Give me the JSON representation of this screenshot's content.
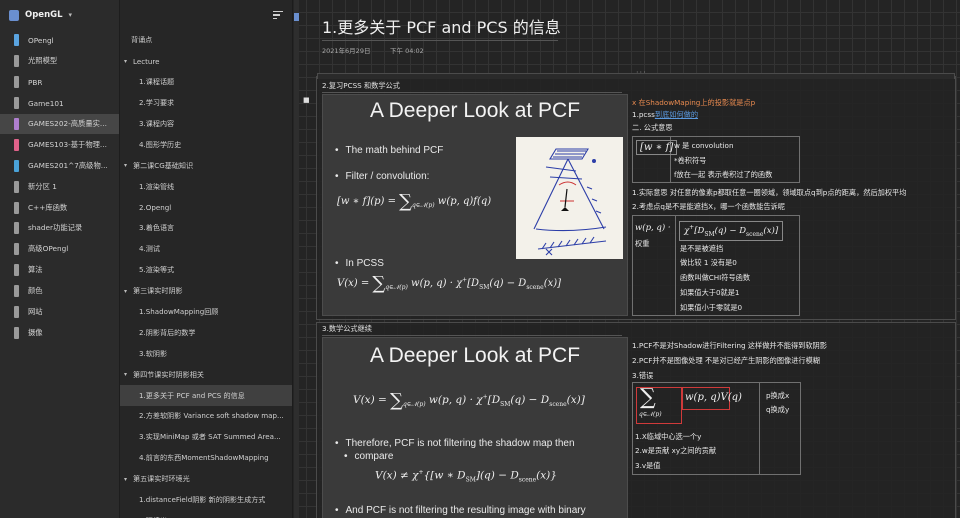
{
  "notebook": {
    "title": "OpenGL"
  },
  "notebooks": [
    {
      "label": "OPengl",
      "color": "#5aa4e0",
      "active": false
    },
    {
      "label": "光照模型",
      "color": "#9a9a9a",
      "active": false
    },
    {
      "label": "PBR",
      "color": "#9a9a9a",
      "active": false
    },
    {
      "label": "Game101",
      "color": "#9a9a9a",
      "active": false
    },
    {
      "label": "GAMES202-高质量实...",
      "color": "#b07fd0",
      "active": true
    },
    {
      "label": "GAMES103-基于物理...",
      "color": "#e0628a",
      "active": false
    },
    {
      "label": "GAMES201^7高级物...",
      "color": "#4aa2d8",
      "active": false
    },
    {
      "label": "新分区 1",
      "color": "#9a9a9a",
      "active": false
    },
    {
      "label": "C++库函数",
      "color": "#9a9a9a",
      "active": false
    },
    {
      "label": "shader功能记录",
      "color": "#9a9a9a",
      "active": false
    },
    {
      "label": "高级OPengl",
      "color": "#9a9a9a",
      "active": false
    },
    {
      "label": "算法",
      "color": "#9a9a9a",
      "active": false
    },
    {
      "label": "颜色",
      "color": "#9a9a9a",
      "active": false
    },
    {
      "label": "网站",
      "color": "#9a9a9a",
      "active": false
    },
    {
      "label": "摄像",
      "color": "#9a9a9a",
      "active": false
    }
  ],
  "sections": [
    {
      "label": "背诵点",
      "kind": "top"
    },
    {
      "label": "Lecture",
      "kind": "group"
    },
    {
      "label": "1.课程话题",
      "kind": "page"
    },
    {
      "label": "2.学习要求",
      "kind": "page"
    },
    {
      "label": "3.课程内容",
      "kind": "page"
    },
    {
      "label": "4.图形学历史",
      "kind": "page"
    },
    {
      "label": "第二课CG基础知识",
      "kind": "group"
    },
    {
      "label": "1.渲染管线",
      "kind": "page"
    },
    {
      "label": "2.Opengl",
      "kind": "page"
    },
    {
      "label": "3.着色语言",
      "kind": "page"
    },
    {
      "label": "4.测试",
      "kind": "page"
    },
    {
      "label": "5.渲染等式",
      "kind": "page"
    },
    {
      "label": "第三课实时阴影",
      "kind": "group"
    },
    {
      "label": "1.ShadowMapping回顾",
      "kind": "page"
    },
    {
      "label": "2.阴影背后的数学",
      "kind": "page"
    },
    {
      "label": "3.软阴影",
      "kind": "page"
    },
    {
      "label": "第四节课实时阴影相关",
      "kind": "group"
    },
    {
      "label": "1.更多关于 PCF and PCS 的信息",
      "kind": "page",
      "active": true
    },
    {
      "label": "2.方差软阴影 Variance soft shadow map...",
      "kind": "page"
    },
    {
      "label": "3.实现MiniMap 或者 SAT Summed Area...",
      "kind": "page"
    },
    {
      "label": "4.前言的东西MomentShadowMapping",
      "kind": "page"
    },
    {
      "label": "第五课实时环境光",
      "kind": "group"
    },
    {
      "label": "1.distanceField阴影 新的阴影生成方式",
      "kind": "page"
    },
    {
      "label": "2.环境光",
      "kind": "page"
    }
  ],
  "page": {
    "title": "1.更多关于 PCF and PCS 的信息",
    "date": "2021年6月29日",
    "time": "下午 04:02"
  },
  "block1": {
    "heading": "2.复习PCSS 和数学公式",
    "slide_title": "A Deeper Look at PCF",
    "bullet1": "The math behind PCF",
    "bullet2": "Filter / convolution:",
    "bullet3": "In PCSS",
    "notes": {
      "line1": "x 在ShadowMaping上的投影就是点p",
      "line2_prefix": "1.pcss",
      "line2_link": "到底如何做的",
      "line3": "二. 公式意思",
      "def_title": "w 是 convolution",
      "def_star": "*卷积符号",
      "def_f": "f放在一起 表示卷积过了的函数",
      "line4": "1.实际意思 对任意的像素p都取任意一圈领域，领域取点q到p点的距离，然后加权平均",
      "line5": "2.考虑点q是不是能遮挡X，哪一个函数能告诉呢",
      "weight": "权重",
      "chi1": "是不是被遮挡",
      "chi2": "做比较 1 没有是0",
      "chi3": "函数叫做CHI符号函数",
      "chi4": "如果值大于0就是1",
      "chi5": "如果值小于零就是0"
    }
  },
  "block2": {
    "heading": "3.数学公式继续",
    "slide_title": "A Deeper Look at PCF",
    "bullet1": "Therefore, PCF is not filtering the shadow map then",
    "bullet1b": "compare",
    "bullet2": "And PCF is not filtering the resulting image with binary",
    "notes": {
      "line1": "1.PCF不是对Shadow进行Filtering 这样做并不能得到软阴影",
      "line2": "2.PCF并不是图像处理 不是对已经产生阴影的图像进行模糊",
      "line3": "3.错误",
      "px": "p换成x",
      "qy": "q换成y",
      "e1": "1.X临域中心选一个y",
      "e2": "2.w是贡献 xy之间的贡献",
      "e3": "3.v是值"
    }
  }
}
